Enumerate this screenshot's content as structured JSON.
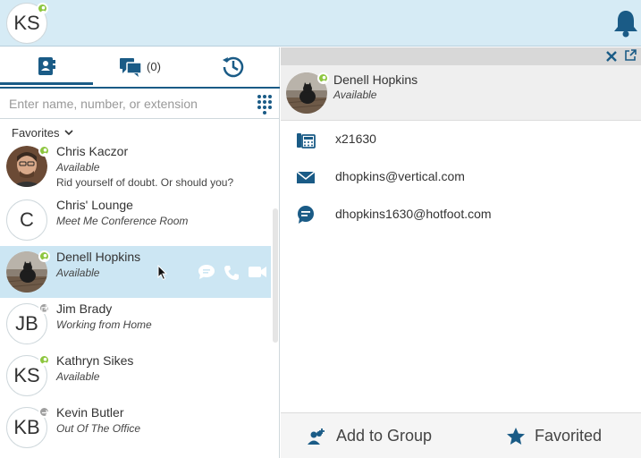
{
  "me": {
    "initials": "KS"
  },
  "tabs": {
    "chat_count": "(0)"
  },
  "search": {
    "placeholder": "Enter name, number, or extension"
  },
  "favorites": {
    "label": "Favorites"
  },
  "contacts": [
    {
      "name": "Chris Kaczor",
      "status": "Available",
      "note": "Rid yourself of doubt. Or should you?",
      "avatar": "photo"
    },
    {
      "name": "Chris' Lounge",
      "status": "Meet Me Conference Room",
      "initials": "C"
    },
    {
      "name": "Denell Hopkins",
      "status": "Available",
      "avatar": "photo"
    },
    {
      "name": "Jim Brady",
      "status": "Working from Home",
      "initials": "JB"
    },
    {
      "name": "Kathryn Sikes",
      "status": "Available",
      "initials": "KS"
    },
    {
      "name": "Kevin Butler",
      "status": "Out Of The Office",
      "initials": "KB"
    }
  ],
  "detail": {
    "name": "Denell Hopkins",
    "status": "Available",
    "extension": "x21630",
    "email": "dhopkins@vertical.com",
    "chat": "dhopkins1630@hotfoot.com"
  },
  "actions": {
    "add_to_group": "Add to Group",
    "favorited": "Favorited"
  },
  "colors": {
    "accent": "#1a5b86",
    "available": "#8dc63f",
    "selected": "#cce6f3",
    "topbar": "#d6ebf5"
  }
}
